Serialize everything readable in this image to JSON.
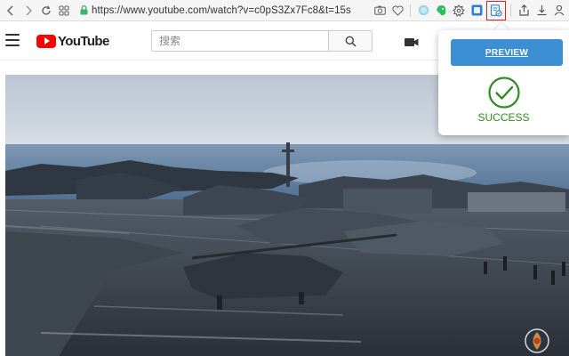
{
  "browser": {
    "url": "https://www.youtube.com/watch?v=c0pS3Zx7Fc8&t=15s",
    "icons": {
      "back": "chevron-left-icon",
      "forward": "chevron-right-icon",
      "reload": "reload-icon",
      "tabs_grid": "tabs-grid-icon",
      "lock": "lock-icon",
      "camera": "camera-icon",
      "heart": "heart-icon",
      "downloads": "download-icon",
      "account": "account-icon"
    },
    "colors": {
      "lock": "#3cb371",
      "highlight_border": "#e02020"
    }
  },
  "youtube": {
    "logo_text": "YouTube",
    "search_placeholder": "搜索",
    "colors": {
      "logo_red": "#ff0000"
    }
  },
  "popup": {
    "preview_label": "PREVIEW",
    "status_text": "SUCCESS",
    "colors": {
      "button": "#3d8fd3",
      "success": "#2e8b1e"
    }
  }
}
